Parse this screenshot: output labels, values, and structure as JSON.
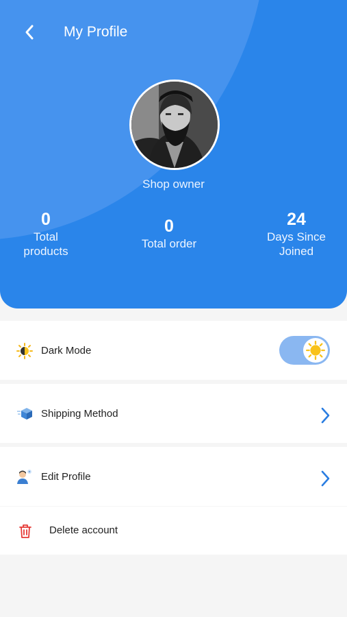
{
  "header": {
    "title": "My Profile",
    "role": "Shop owner",
    "stats": [
      {
        "value": "0",
        "label": "Total\nproducts"
      },
      {
        "value": "0",
        "label": "Total order"
      },
      {
        "value": "24",
        "label": "Days Since\nJoined"
      }
    ]
  },
  "settings": {
    "dark_mode_label": "Dark Mode",
    "dark_mode_enabled": false,
    "shipping_label": "Shipping Method",
    "edit_profile_label": "Edit Profile",
    "delete_label": "Delete account"
  },
  "colors": {
    "primary": "#2a85ea",
    "chevron": "#2a7de1",
    "danger": "#e53935",
    "sun": "#f9c21a"
  }
}
